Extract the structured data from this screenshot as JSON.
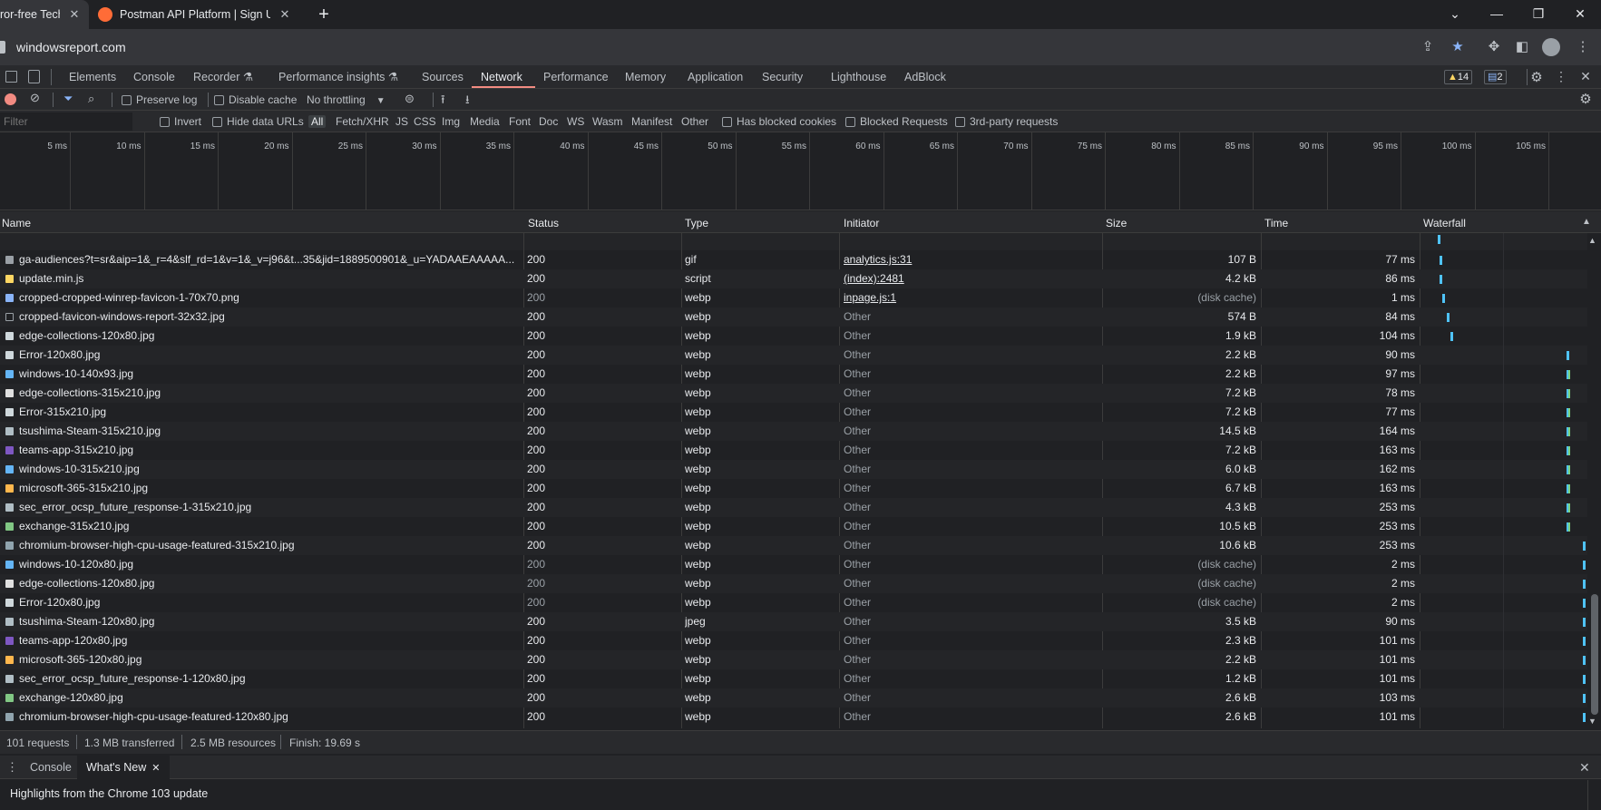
{
  "browser": {
    "tabs": [
      {
        "title": "ror-free Tech",
        "close": "✕"
      },
      {
        "title": "Postman API Platform | Sign Up for Free",
        "close": "✕"
      }
    ],
    "new_tab": "+",
    "url": "windowsreport.com"
  },
  "devtools": {
    "tabs": [
      "Elements",
      "Console",
      "Recorder ⚗",
      "Performance insights ⚗",
      "Sources",
      "Network",
      "Performance",
      "Memory",
      "Application",
      "Security",
      "Lighthouse",
      "AdBlock"
    ],
    "active_tab": "Network",
    "warnings_count": "14",
    "messages_count": "2"
  },
  "toolbar": {
    "preserve_log": "Preserve log",
    "disable_cache": "Disable cache",
    "throttling": "No throttling"
  },
  "filterbar": {
    "filter_placeholder": "Filter",
    "invert": "Invert",
    "hide_data_urls": "Hide data URLs",
    "types": [
      "All",
      "Fetch/XHR",
      "JS",
      "CSS",
      "Img",
      "Media",
      "Font",
      "Doc",
      "WS",
      "Wasm",
      "Manifest",
      "Other"
    ],
    "has_blocked_cookies": "Has blocked cookies",
    "blocked_requests": "Blocked Requests",
    "third_party": "3rd-party requests"
  },
  "timeline": {
    "ticks": [
      "5 ms",
      "10 ms",
      "15 ms",
      "20 ms",
      "25 ms",
      "30 ms",
      "35 ms",
      "40 ms",
      "45 ms",
      "50 ms",
      "55 ms",
      "60 ms",
      "65 ms",
      "70 ms",
      "75 ms",
      "80 ms",
      "85 ms",
      "90 ms",
      "95 ms",
      "100 ms",
      "105 ms"
    ]
  },
  "grid": {
    "columns": [
      "Name",
      "Status",
      "Type",
      "Initiator",
      "Size",
      "Time",
      "Waterfall"
    ],
    "rows": [
      {
        "name": "ga-audiences?t=sr&aip=1&_r=4&slf_rd=1&v=1&_v=j96&t...35&jid=1889500901&_u=YADAAEAAAAA...",
        "status": "200",
        "type": "gif",
        "initiator": "analytics.js:31",
        "size": "107 B",
        "time": "77 ms"
      },
      {
        "name": "update.min.js",
        "status": "200",
        "type": "script",
        "initiator": "(index):2481",
        "size": "4.2 kB",
        "time": "86 ms"
      },
      {
        "name": "cropped-cropped-winrep-favicon-1-70x70.png",
        "status": "200",
        "type": "webp",
        "initiator": "inpage.js:1",
        "size": "(disk cache)",
        "time": "1 ms"
      },
      {
        "name": "cropped-favicon-windows-report-32x32.jpg",
        "status": "200",
        "type": "webp",
        "initiator": "Other",
        "size": "574 B",
        "time": "84 ms"
      },
      {
        "name": "edge-collections-120x80.jpg",
        "status": "200",
        "type": "webp",
        "initiator": "Other",
        "size": "1.9 kB",
        "time": "104 ms"
      },
      {
        "name": "Error-120x80.jpg",
        "status": "200",
        "type": "webp",
        "initiator": "Other",
        "size": "2.2 kB",
        "time": "90 ms"
      },
      {
        "name": "windows-10-140x93.jpg",
        "status": "200",
        "type": "webp",
        "initiator": "Other",
        "size": "2.2 kB",
        "time": "97 ms"
      },
      {
        "name": "edge-collections-315x210.jpg",
        "status": "200",
        "type": "webp",
        "initiator": "Other",
        "size": "7.2 kB",
        "time": "78 ms"
      },
      {
        "name": "Error-315x210.jpg",
        "status": "200",
        "type": "webp",
        "initiator": "Other",
        "size": "7.2 kB",
        "time": "77 ms"
      },
      {
        "name": "tsushima-Steam-315x210.jpg",
        "status": "200",
        "type": "webp",
        "initiator": "Other",
        "size": "14.5 kB",
        "time": "164 ms"
      },
      {
        "name": "teams-app-315x210.jpg",
        "status": "200",
        "type": "webp",
        "initiator": "Other",
        "size": "7.2 kB",
        "time": "163 ms"
      },
      {
        "name": "windows-10-315x210.jpg",
        "status": "200",
        "type": "webp",
        "initiator": "Other",
        "size": "6.0 kB",
        "time": "162 ms"
      },
      {
        "name": "microsoft-365-315x210.jpg",
        "status": "200",
        "type": "webp",
        "initiator": "Other",
        "size": "6.7 kB",
        "time": "163 ms"
      },
      {
        "name": "sec_error_ocsp_future_response-1-315x210.jpg",
        "status": "200",
        "type": "webp",
        "initiator": "Other",
        "size": "4.3 kB",
        "time": "253 ms"
      },
      {
        "name": "exchange-315x210.jpg",
        "status": "200",
        "type": "webp",
        "initiator": "Other",
        "size": "10.5 kB",
        "time": "253 ms"
      },
      {
        "name": "chromium-browser-high-cpu-usage-featured-315x210.jpg",
        "status": "200",
        "type": "webp",
        "initiator": "Other",
        "size": "10.6 kB",
        "time": "253 ms"
      },
      {
        "name": "windows-10-120x80.jpg",
        "status": "200",
        "type": "webp",
        "initiator": "Other",
        "size": "(disk cache)",
        "time": "2 ms"
      },
      {
        "name": "edge-collections-120x80.jpg",
        "status": "200",
        "type": "webp",
        "initiator": "Other",
        "size": "(disk cache)",
        "time": "2 ms"
      },
      {
        "name": "Error-120x80.jpg",
        "status": "200",
        "type": "webp",
        "initiator": "Other",
        "size": "(disk cache)",
        "time": "2 ms"
      },
      {
        "name": "tsushima-Steam-120x80.jpg",
        "status": "200",
        "type": "jpeg",
        "initiator": "Other",
        "size": "3.5 kB",
        "time": "90 ms"
      },
      {
        "name": "teams-app-120x80.jpg",
        "status": "200",
        "type": "webp",
        "initiator": "Other",
        "size": "2.3 kB",
        "time": "101 ms"
      },
      {
        "name": "microsoft-365-120x80.jpg",
        "status": "200",
        "type": "webp",
        "initiator": "Other",
        "size": "2.2 kB",
        "time": "101 ms"
      },
      {
        "name": "sec_error_ocsp_future_response-1-120x80.jpg",
        "status": "200",
        "type": "webp",
        "initiator": "Other",
        "size": "1.2 kB",
        "time": "101 ms"
      },
      {
        "name": "exchange-120x80.jpg",
        "status": "200",
        "type": "webp",
        "initiator": "Other",
        "size": "2.6 kB",
        "time": "103 ms"
      },
      {
        "name": "chromium-browser-high-cpu-usage-featured-120x80.jpg",
        "status": "200",
        "type": "webp",
        "initiator": "Other",
        "size": "2.6 kB",
        "time": "101 ms"
      }
    ]
  },
  "summary": {
    "requests": "101 requests",
    "transferred": "1.3 MB transferred",
    "resources": "2.5 MB resources",
    "finish": "Finish: 19.69 s"
  },
  "drawer": {
    "tabs": [
      "Console",
      "What's New"
    ],
    "active_tab": "What's New",
    "highlight": "Highlights from the Chrome 103 update"
  },
  "colors": {
    "accent": "#f28b82",
    "link": "#8ab4f8",
    "waterfall": "#4fc3f7"
  }
}
